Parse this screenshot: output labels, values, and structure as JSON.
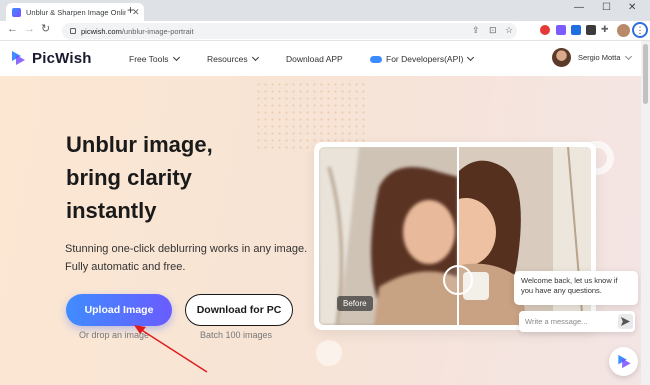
{
  "browser": {
    "tab_title": "Unblur & Sharpen Image Online",
    "tab_close": "✕",
    "new_tab": "+",
    "url_host": "picwish.com",
    "url_path": "/unblur-image-portrait",
    "window_minimize": "—",
    "window_maximize": "☐",
    "window_close": "✕"
  },
  "site": {
    "logo_text": "PicWish",
    "nav": {
      "free_tools": "Free Tools",
      "resources": "Resources",
      "download_app": "Download APP",
      "developers": "For Developers(API)"
    },
    "user_name": "Sergio Motta"
  },
  "hero": {
    "headline_line1": "Unblur image,",
    "headline_line2": "bring clarity",
    "headline_line3": "instantly",
    "subtitle": "Stunning one-click deblurring works in any image. Fully automatic and free.",
    "upload_button": "Upload Image",
    "upload_hint": "Or drop an image",
    "download_button": "Download for PC",
    "download_hint": "Batch 100 images",
    "before_label": "Before"
  },
  "chat": {
    "message": "Welcome back, let us know if you have any questions.",
    "input_placeholder": "Write a message..."
  },
  "colors": {
    "accent_blue": "#3f8cff",
    "accent_purple": "#6a5cff",
    "annotation_red": "#e01b1b"
  }
}
